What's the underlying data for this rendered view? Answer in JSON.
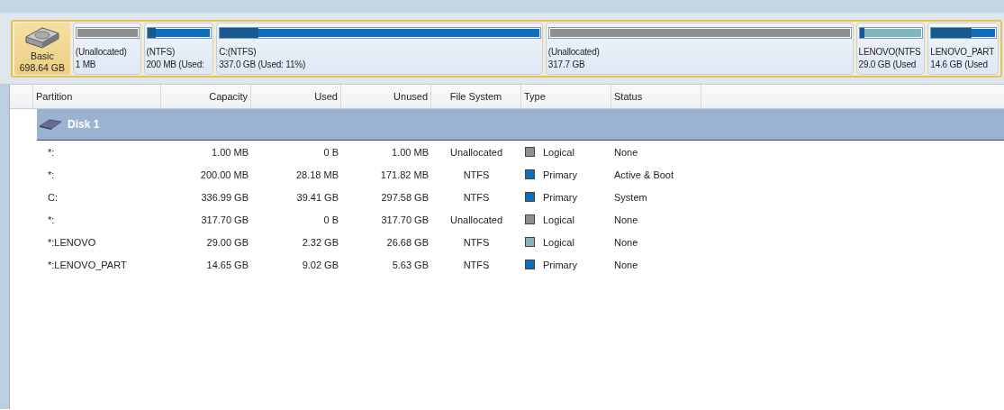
{
  "disk_map": {
    "disk": {
      "label": "Basic",
      "size": "698.64 GB"
    },
    "partitions": [
      {
        "label": "(Unallocated)",
        "size": "1 MB",
        "color": "#8f8f8f"
      },
      {
        "label": "(NTFS)",
        "size": "200 MB (Used:",
        "color": "#0b6fbe",
        "level": 0.14
      },
      {
        "label": "C:(NTFS)",
        "size": "337.0 GB (Used: 11%)",
        "color": "#0b6fbe",
        "level": 0.12
      },
      {
        "label": "(Unallocated)",
        "size": "317.7 GB",
        "color": "#8f8f8f"
      },
      {
        "label": "LENOVO(NTFS",
        "size": "29.0 GB (Used",
        "color": "#80b6bd",
        "level": 0.08
      },
      {
        "label": "LENOVO_PART",
        "size": "14.6 GB (Used",
        "color": "#0b6fbe",
        "level": 0.62
      }
    ]
  },
  "table": {
    "columns": [
      "Partition",
      "Capacity",
      "Used",
      "Unused",
      "File System",
      "Type",
      "Status"
    ],
    "disk": "Disk 1",
    "rows": [
      {
        "partition": "*:",
        "capacity": "1.00 MB",
        "used": "0 B",
        "unused": "1.00 MB",
        "file_system": "Unallocated",
        "type": "Logical",
        "color": "#8f8f8f",
        "status": "None"
      },
      {
        "partition": "*:",
        "capacity": "200.00 MB",
        "used": "28.18 MB",
        "unused": "171.82 MB",
        "file_system": "NTFS",
        "type": "Primary",
        "color": "#0b6fbe",
        "status": "Active & Boot"
      },
      {
        "partition": "C:",
        "capacity": "336.99 GB",
        "used": "39.41 GB",
        "unused": "297.58 GB",
        "file_system": "NTFS",
        "type": "Primary",
        "color": "#0b6fbe",
        "status": "System"
      },
      {
        "partition": "*:",
        "capacity": "317.70 GB",
        "used": "0 B",
        "unused": "317.70 GB",
        "file_system": "Unallocated",
        "type": "Logical",
        "color": "#8f8f8f",
        "status": "None"
      },
      {
        "partition": "*:LENOVO",
        "capacity": "29.00 GB",
        "used": "2.32 GB",
        "unused": "26.68 GB",
        "file_system": "NTFS",
        "type": "Logical",
        "color": "#80b6bd",
        "status": "None"
      },
      {
        "partition": "*:LENOVO_PART",
        "capacity": "14.65 GB",
        "used": "9.02 GB",
        "unused": "5.63 GB",
        "file_system": "NTFS",
        "type": "Primary",
        "color": "#0b6fbe",
        "status": "None"
      }
    ]
  }
}
